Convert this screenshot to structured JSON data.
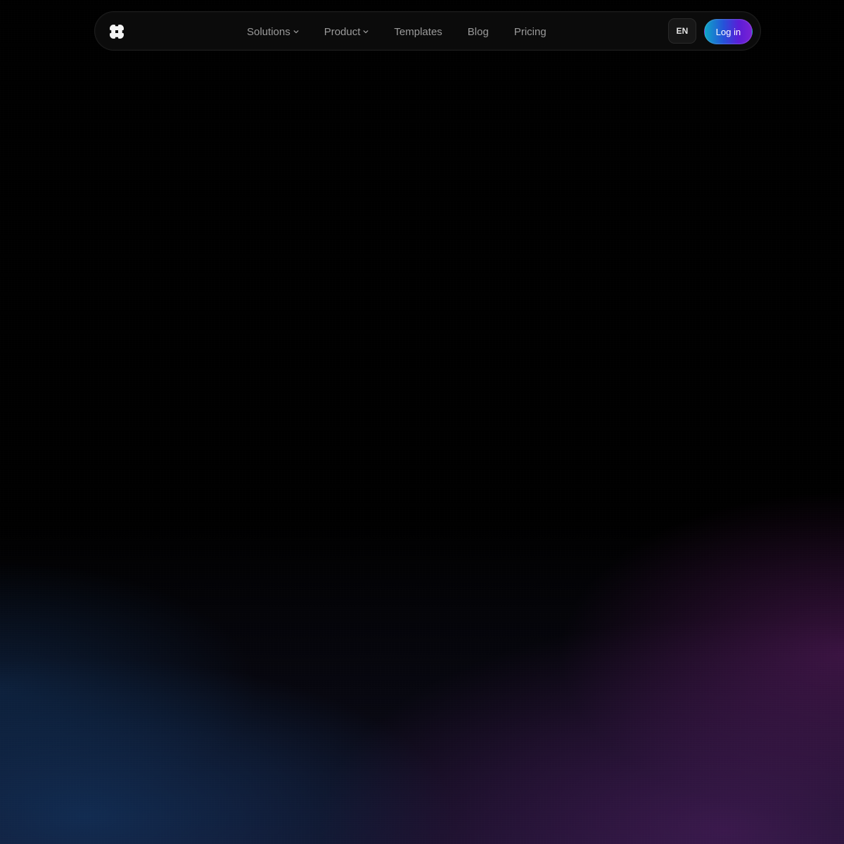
{
  "colors": {
    "background": "#000000",
    "nav_background": "#0b0b0b",
    "nav_text": "#9a9a9a",
    "button_text": "#ffffff",
    "lang_button_background": "#171717",
    "login_gradient_start": "#0ea5c7",
    "login_gradient_mid": "#2552d9",
    "login_gradient_end": "#7a22d4",
    "glow_left": "#123866",
    "glow_right": "#5c2270"
  },
  "header": {
    "logo_icon": "four-petal-logo",
    "nav": [
      {
        "label": "Solutions",
        "has_dropdown": true,
        "icon": "chevron-down-icon"
      },
      {
        "label": "Product",
        "has_dropdown": true,
        "icon": "chevron-down-icon"
      },
      {
        "label": "Templates",
        "has_dropdown": false
      },
      {
        "label": "Blog",
        "has_dropdown": false
      },
      {
        "label": "Pricing",
        "has_dropdown": false
      }
    ],
    "language": "EN",
    "login_label": "Log in"
  }
}
